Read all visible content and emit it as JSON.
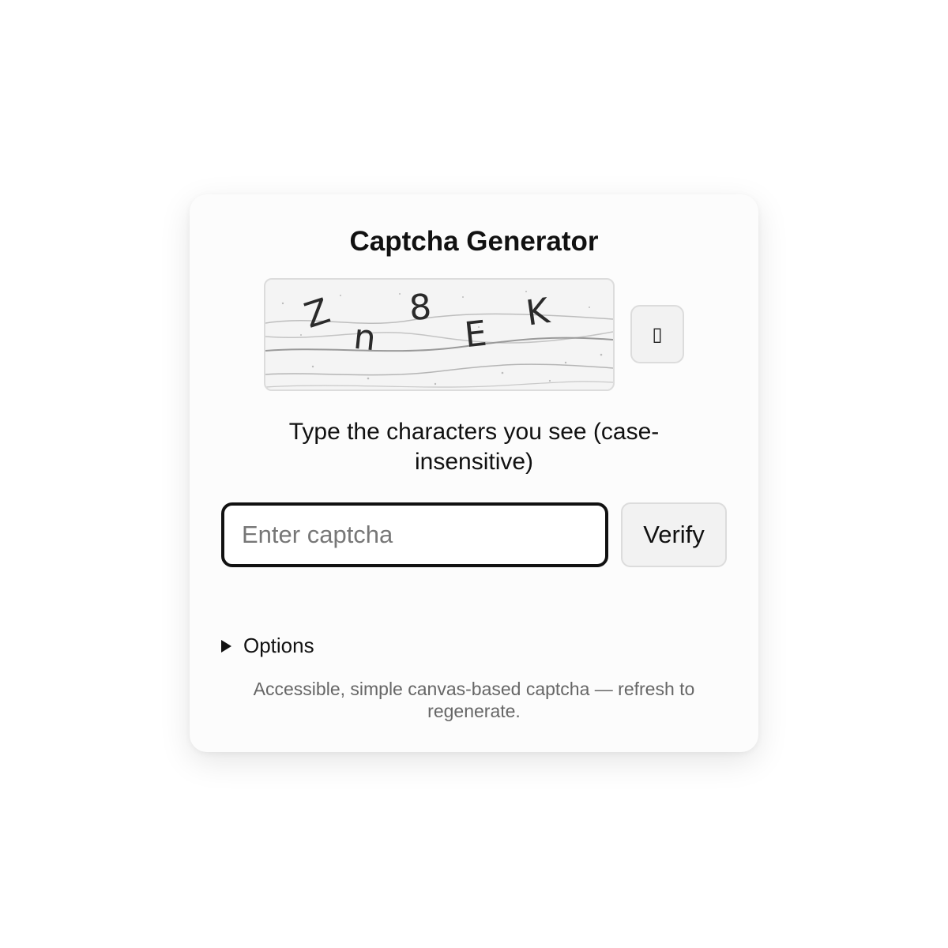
{
  "app": {
    "title": "Captcha Generator"
  },
  "captcha": {
    "characters": [
      "Z",
      "n",
      "8",
      "E",
      "K"
    ],
    "refresh_icon": "refresh-icon",
    "refresh_glyph": "▯"
  },
  "instruction": "Type the characters you see (case-insensitive)",
  "input": {
    "value": "",
    "placeholder": "Enter captcha"
  },
  "verify_label": "Verify",
  "options_label": "Options",
  "footer_text": "Accessible, simple canvas-based captcha — refresh to regenerate.",
  "colors": {
    "text": "#111111",
    "muted": "#666666",
    "border": "#dcdcdc",
    "button_bg": "#f2f2f2"
  }
}
